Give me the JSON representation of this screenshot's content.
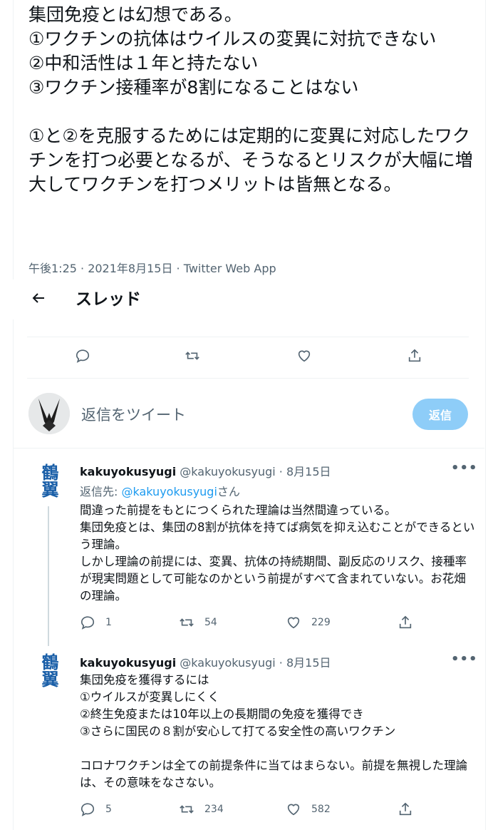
{
  "main_tweet": {
    "text": "集団免疫とは幻想である。\n①ワクチンの抗体はウイルスの変異に対抗できない\n②中和活性は１年と持たない\n③ワクチン接種率が8割になることはない\n\n①と②を克服するためには定期的に変異に対応したワクチンを打つ必要となるが、そうなるとリスクが大幅に増大してワクチンを打つメリットは皆無となる。",
    "meta": "午後1:25 · 2021年8月15日 · Twitter Web App"
  },
  "thread_bar": {
    "title": "スレッド",
    "icon": "arrow-left-icon"
  },
  "reply_box": {
    "placeholder": "返信をツイート",
    "button_label": "返信"
  },
  "replies": [
    {
      "avatar_text": "鶴翼",
      "name": "kakuyokusyugi",
      "handle_date": "@kakuyokusyugi · 8月15日",
      "replying_prefix": "返信先: ",
      "replying_handle": "@kakuyokusyugi",
      "replying_suffix": "さん",
      "text": "間違った前提をもとにつくられた理論は当然間違っている。\n集団免疫とは、集団の8割が抗体を持てば病気を抑え込むことができるという理論。\nしかし理論の前提には、変異、抗体の持続期間、副反応のリスク、接種率が現実問題として可能なのかという前提がすべて含まれていない。お花畑の理論。",
      "replies": "1",
      "retweets": "54",
      "likes": "229"
    },
    {
      "avatar_text": "鶴翼",
      "name": "kakuyokusyugi",
      "handle_date": "@kakuyokusyugi · 8月15日",
      "text": "集団免疫を獲得するには\n①ウイルスが変異しにくく\n②終生免疫または10年以上の長期間の免疫を獲得でき\n③さらに国民の８割が安心して打てる安全性の高いワクチン\n\nコロナワクチンは全ての前提条件に当てはまらない。前提を無視した理論は、その意味をなさない。",
      "replies": "5",
      "retweets": "234",
      "likes": "582"
    }
  ],
  "more_label": "•••"
}
